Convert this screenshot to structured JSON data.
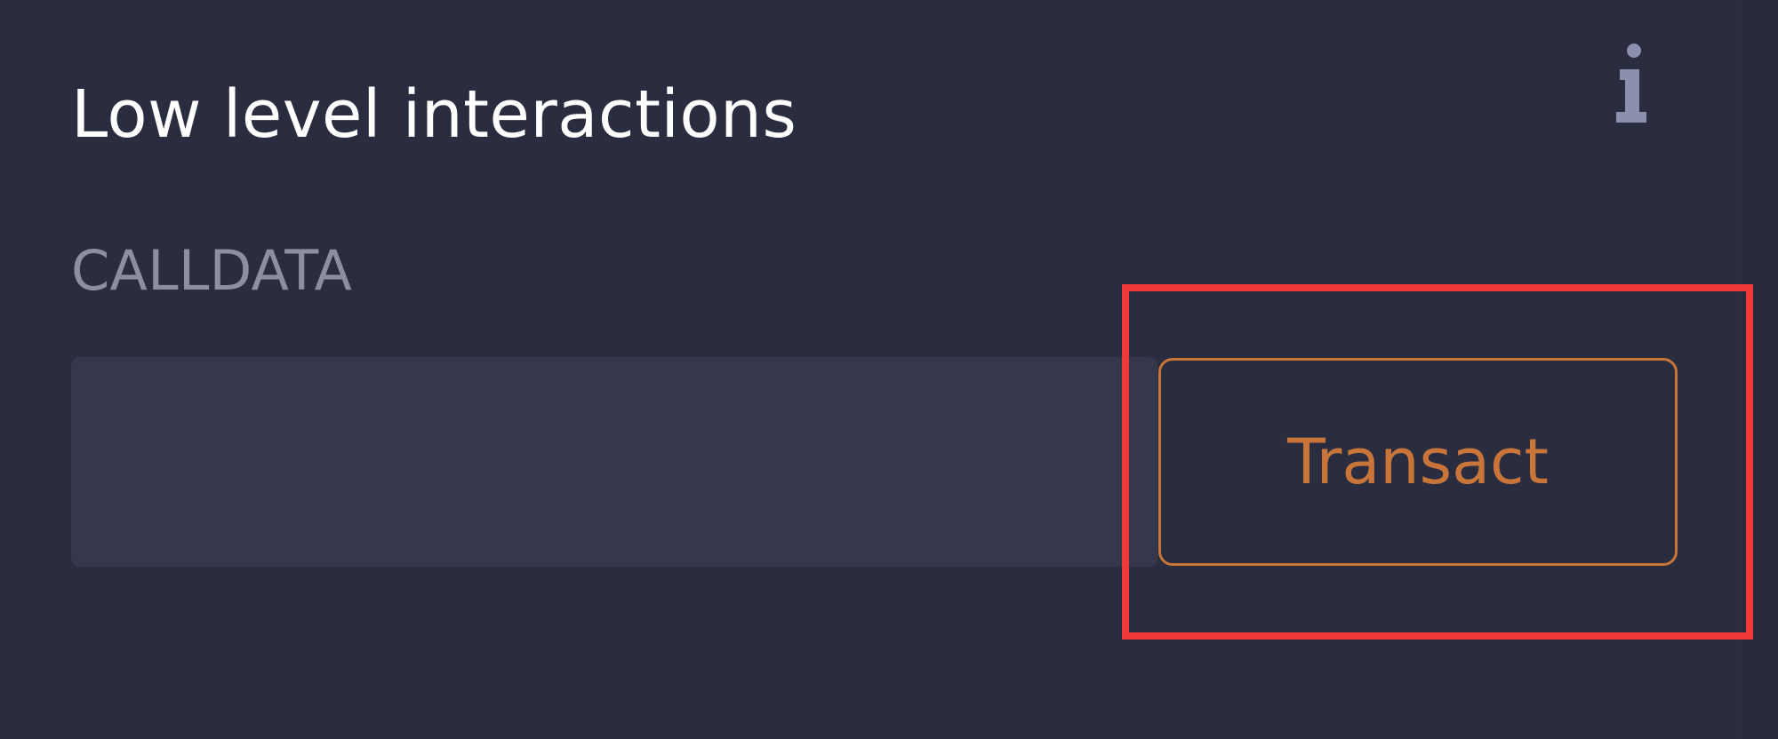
{
  "section": {
    "title": "Low level interactions",
    "info_icon": "info-icon"
  },
  "calldata": {
    "label": "CALLDATA",
    "value": "",
    "placeholder": ""
  },
  "actions": {
    "transact_label": "Transact"
  },
  "annotation": {
    "highlight_color": "#f03a3a",
    "highlight_target": "transact-button"
  },
  "colors": {
    "background": "#2a2c3f",
    "input_background": "#35374c",
    "title_text": "#ffffff",
    "label_text": "#8b8fa1",
    "accent_orange": "#c97539",
    "icon_color": "#8a90ad"
  }
}
